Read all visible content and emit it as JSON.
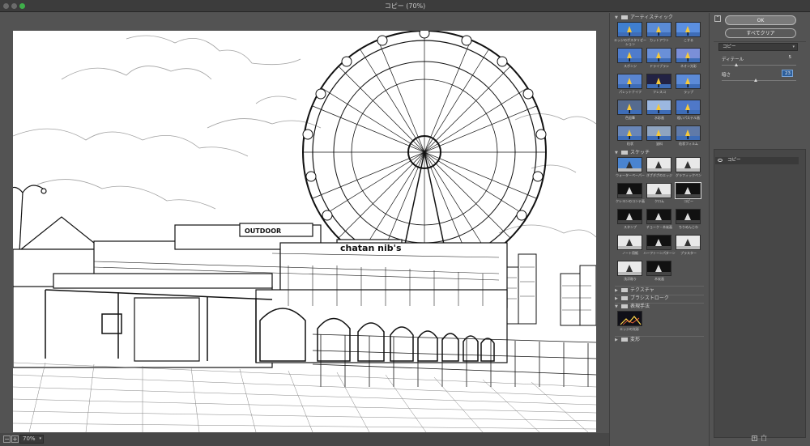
{
  "window": {
    "title": "コピー (70%)"
  },
  "statusbar": {
    "zoom_minus": "−",
    "zoom_plus": "+",
    "zoom_value": "70%"
  },
  "gallery": {
    "categories": [
      {
        "label": "アーティスティック",
        "expanded": true
      },
      {
        "label": "スケッチ",
        "expanded": true
      },
      {
        "label": "テクスチャ",
        "expanded": false
      },
      {
        "label": "ブラシストローク",
        "expanded": false
      },
      {
        "label": "表現手法",
        "expanded": true
      },
      {
        "label": "変形",
        "expanded": false
      }
    ],
    "artistic_filters": [
      "エッジのポスタリゼーション",
      "カットアウト",
      "こする",
      "スポンジ",
      "ドライブラシ",
      "ネオン光彩",
      "パレットナイフ",
      "フレスコ",
      "ラップ",
      "色鉛筆",
      "水彩画",
      "粗いパステル画",
      "粒状",
      "塗料",
      "粒状フィルム"
    ],
    "sketch_filters": [
      "ウォーターペーパー",
      "ぎざぎざのエッジ",
      "グラフィックペン",
      "クレヨンのコンテ画",
      "クロム",
      "コピー",
      "スタンプ",
      "チョーク・木炭画",
      "ちりめんじわ",
      "ノート用紙",
      "ハーフトーンパターン",
      "プラスター",
      "浅浮彫り",
      "木炭画"
    ],
    "stylize_filters": [
      "エッジの光彩"
    ],
    "selected_filter": "コピー"
  },
  "options": {
    "toggle": "⌃",
    "ok_label": "OK",
    "clear_label": "すべてクリア",
    "filter_select": "コピー",
    "params": [
      {
        "label": "ディテール",
        "value": "5",
        "fraction": 0.2
      },
      {
        "label": "暗さ",
        "value": "23",
        "fraction": 0.46
      }
    ],
    "layer_name": "コピー",
    "new_layer": "+",
    "delete_layer": "🗑"
  },
  "colors": {
    "panel": "#535353",
    "accent": "#2d5f9c",
    "ok_border": "#b8b8b8"
  }
}
